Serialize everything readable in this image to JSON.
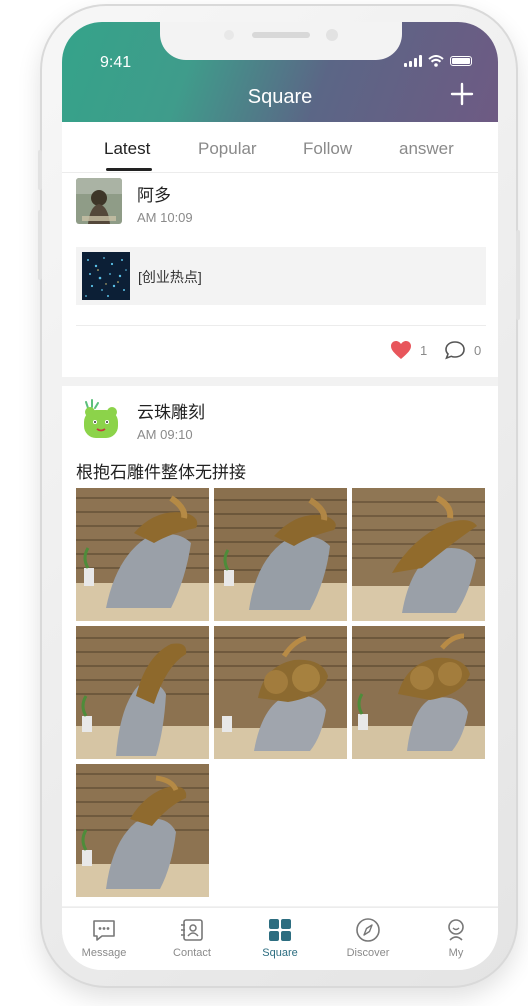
{
  "status_bar": {
    "time": "9:41"
  },
  "header": {
    "title": "Square"
  },
  "tabs": [
    {
      "label": "Latest",
      "active": true
    },
    {
      "label": "Popular",
      "active": false
    },
    {
      "label": "Follow",
      "active": false
    },
    {
      "label": "answer",
      "active": false
    }
  ],
  "posts": [
    {
      "user": "阿多",
      "time": "AM 10:09",
      "shared_link": {
        "title": "[创业热点]"
      },
      "likes": "1",
      "comments": "0"
    },
    {
      "user": "云珠雕刻",
      "time": "AM 09:10",
      "text": "根抱石雕件整体无拼接",
      "image_count": 7
    }
  ],
  "bottom_nav": [
    {
      "label": "Message",
      "icon": "message-icon"
    },
    {
      "label": "Contact",
      "icon": "contact-icon"
    },
    {
      "label": "Square",
      "icon": "square-icon",
      "active": true
    },
    {
      "label": "Discover",
      "icon": "compass-icon"
    },
    {
      "label": "My",
      "icon": "person-icon"
    }
  ],
  "colors": {
    "accent": "#2c6d80",
    "like": "#e8565c",
    "header_start": "#35a38a",
    "header_end": "#6e5a83"
  }
}
